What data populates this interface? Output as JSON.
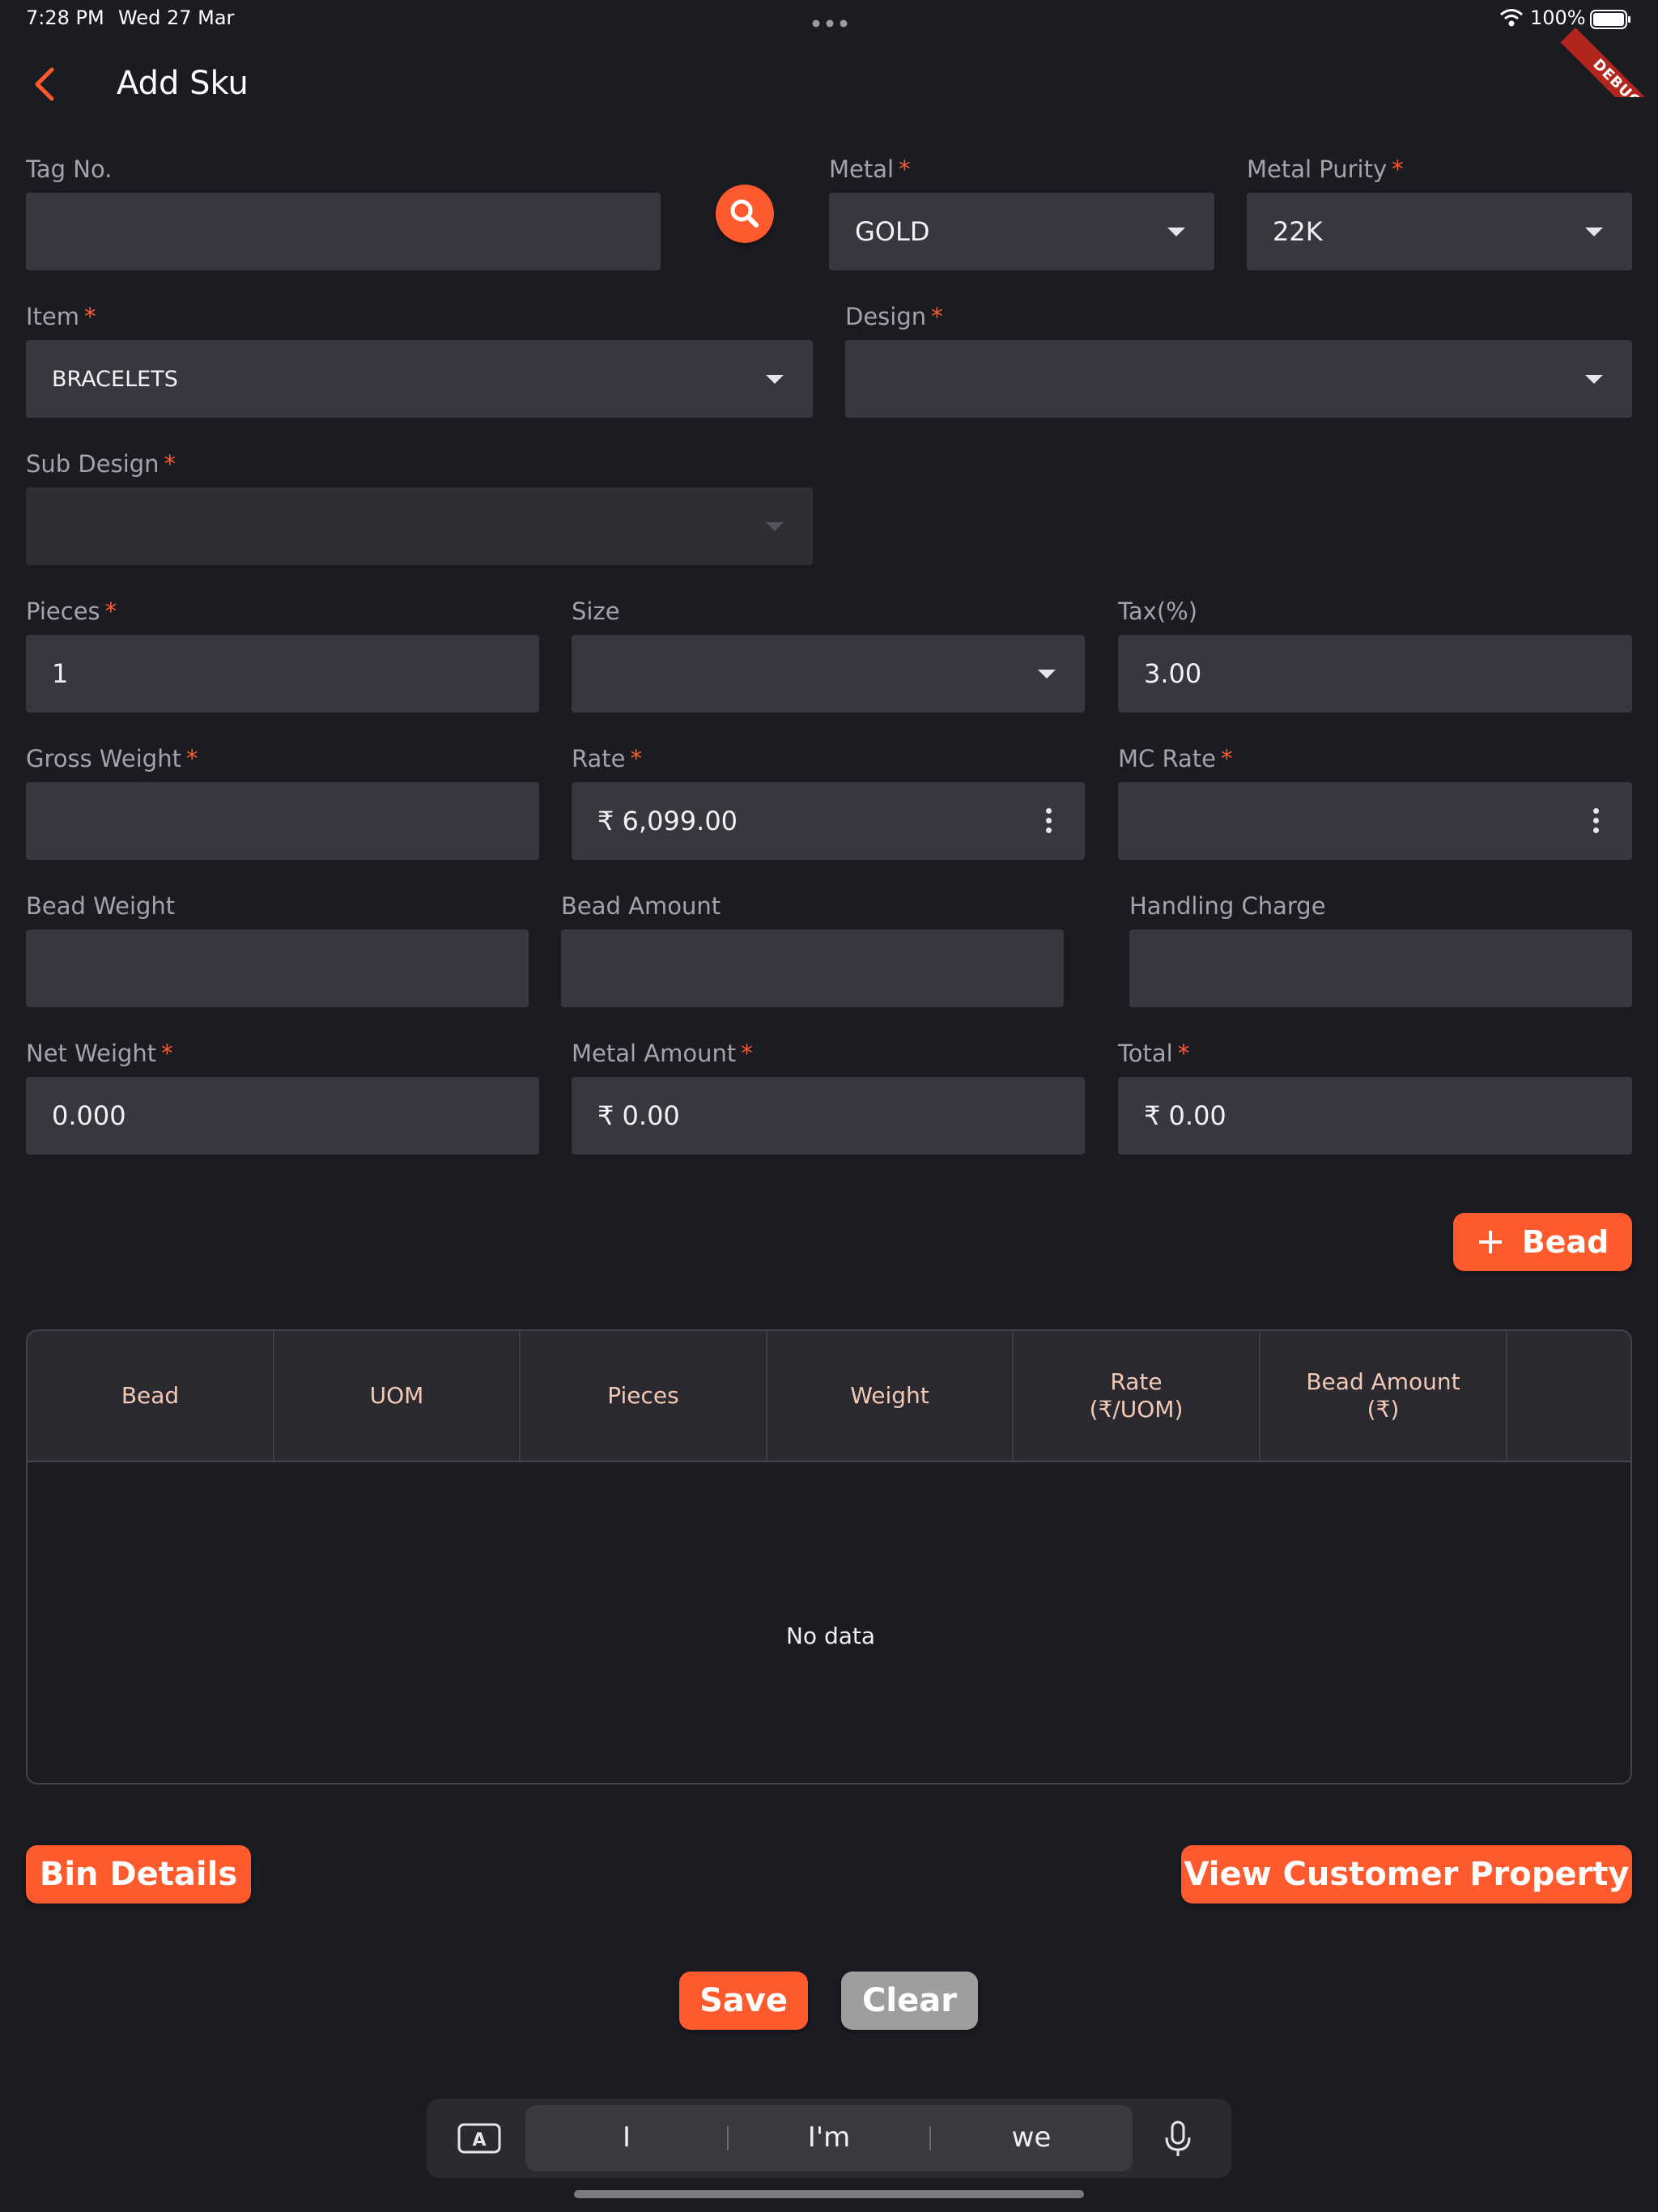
{
  "status_bar": {
    "time": "7:28 PM",
    "date": "Wed 27 Mar",
    "battery": "100%"
  },
  "debug_banner": "DEBUG",
  "header": {
    "title": "Add Sku"
  },
  "colors": {
    "accent": "#ff5a2e",
    "background": "#1b1b22",
    "field": "#38373f",
    "required": "#ff5a2e"
  },
  "form": {
    "tag_no": {
      "label": "Tag No.",
      "value": ""
    },
    "metal": {
      "label": "Metal",
      "required": "*",
      "value": "GOLD"
    },
    "metal_purity": {
      "label": "Metal Purity",
      "required": "*",
      "value": "22K"
    },
    "item": {
      "label": "Item",
      "required": "*",
      "value": "BRACELETS"
    },
    "design": {
      "label": "Design",
      "required": "*",
      "value": ""
    },
    "sub_design": {
      "label": "Sub Design",
      "required": "*",
      "value": ""
    },
    "pieces": {
      "label": "Pieces",
      "required": "*",
      "value": "1"
    },
    "size": {
      "label": "Size",
      "value": ""
    },
    "tax": {
      "label": "Tax(%)",
      "value": "3.00"
    },
    "gross_weight": {
      "label": "Gross Weight",
      "required": "*",
      "value": ""
    },
    "rate": {
      "label": "Rate",
      "required": "*",
      "value": "₹ 6,099.00"
    },
    "mc_rate": {
      "label": "MC Rate",
      "required": "*",
      "value": ""
    },
    "bead_weight": {
      "label": "Bead Weight",
      "value": ""
    },
    "bead_amount": {
      "label": "Bead Amount",
      "value": ""
    },
    "handling_charge": {
      "label": "Handling Charge",
      "value": ""
    },
    "net_weight": {
      "label": "Net Weight",
      "required": "*",
      "value": "0.000"
    },
    "metal_amount": {
      "label": "Metal Amount",
      "required": "*",
      "value": "₹ 0.00"
    },
    "total": {
      "label": "Total",
      "required": "*",
      "value": "₹ 0.00"
    }
  },
  "add_bead_button": {
    "icon": "plus-icon",
    "label": "Bead"
  },
  "bead_table": {
    "columns": [
      {
        "line1": "Bead",
        "line2": ""
      },
      {
        "line1": "UOM",
        "line2": ""
      },
      {
        "line1": "Pieces",
        "line2": ""
      },
      {
        "line1": "Weight",
        "line2": ""
      },
      {
        "line1": "Rate",
        "line2": "(₹/UOM)"
      },
      {
        "line1": "Bead Amount",
        "line2": "(₹)"
      }
    ],
    "empty_text": "No data"
  },
  "buttons": {
    "bin_details": "Bin Details",
    "view_customer_property": "View Customer Property",
    "save": "Save",
    "clear": "Clear"
  },
  "keyboard_bar": {
    "suggestions": [
      "I",
      "I'm",
      "we"
    ],
    "left_icon": "keyboard-a-icon",
    "right_icon": "microphone-icon"
  }
}
